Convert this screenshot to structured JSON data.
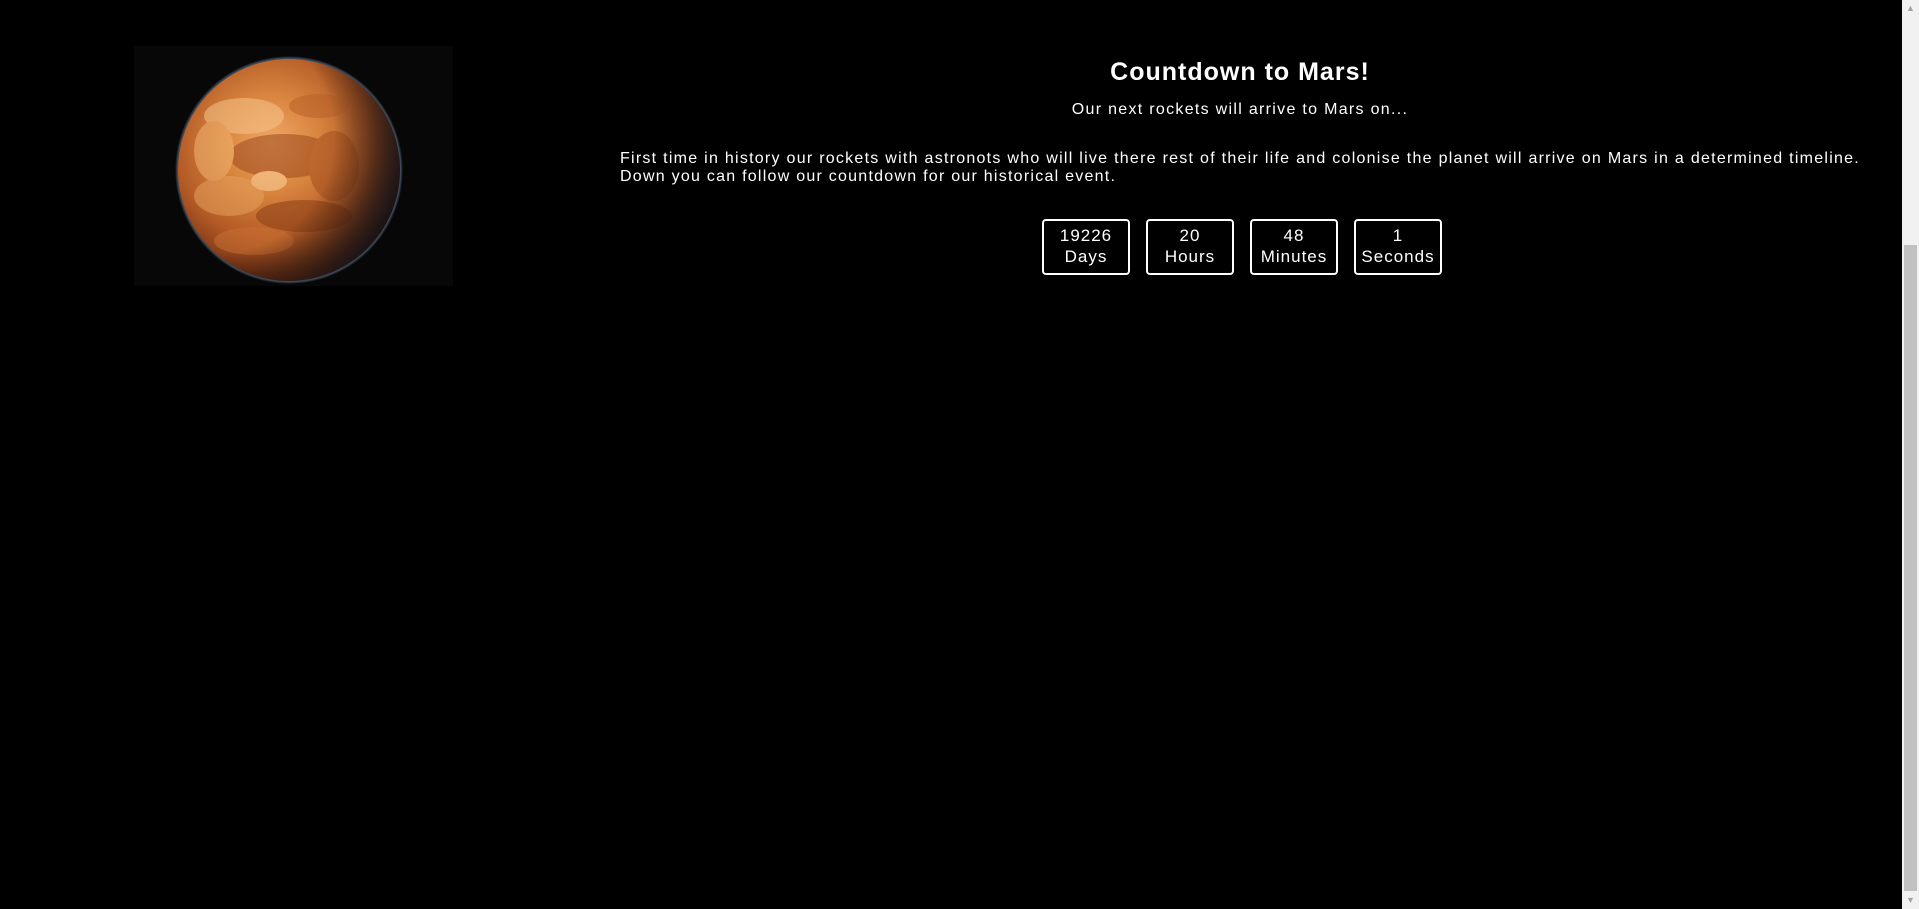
{
  "planet": {
    "icon": "mars-planet-image"
  },
  "header": {
    "title": "Countdown to Mars!",
    "subtitle": "Our next rockets will arrive to Mars on..."
  },
  "description": "First time in history our rockets with astronots who will live there rest of their life and colonise the planet will arrive on Mars in a determined timeline. Down you can follow our countdown for our historical event.",
  "countdown": {
    "days": {
      "value": "19226",
      "label": "Days"
    },
    "hours": {
      "value": "20",
      "label": "Hours"
    },
    "minutes": {
      "value": "48",
      "label": "Minutes"
    },
    "seconds": {
      "value": "1",
      "label": "Seconds"
    }
  },
  "colors": {
    "background": "#000000",
    "text": "#ffffff",
    "planet": "#c0622c"
  }
}
